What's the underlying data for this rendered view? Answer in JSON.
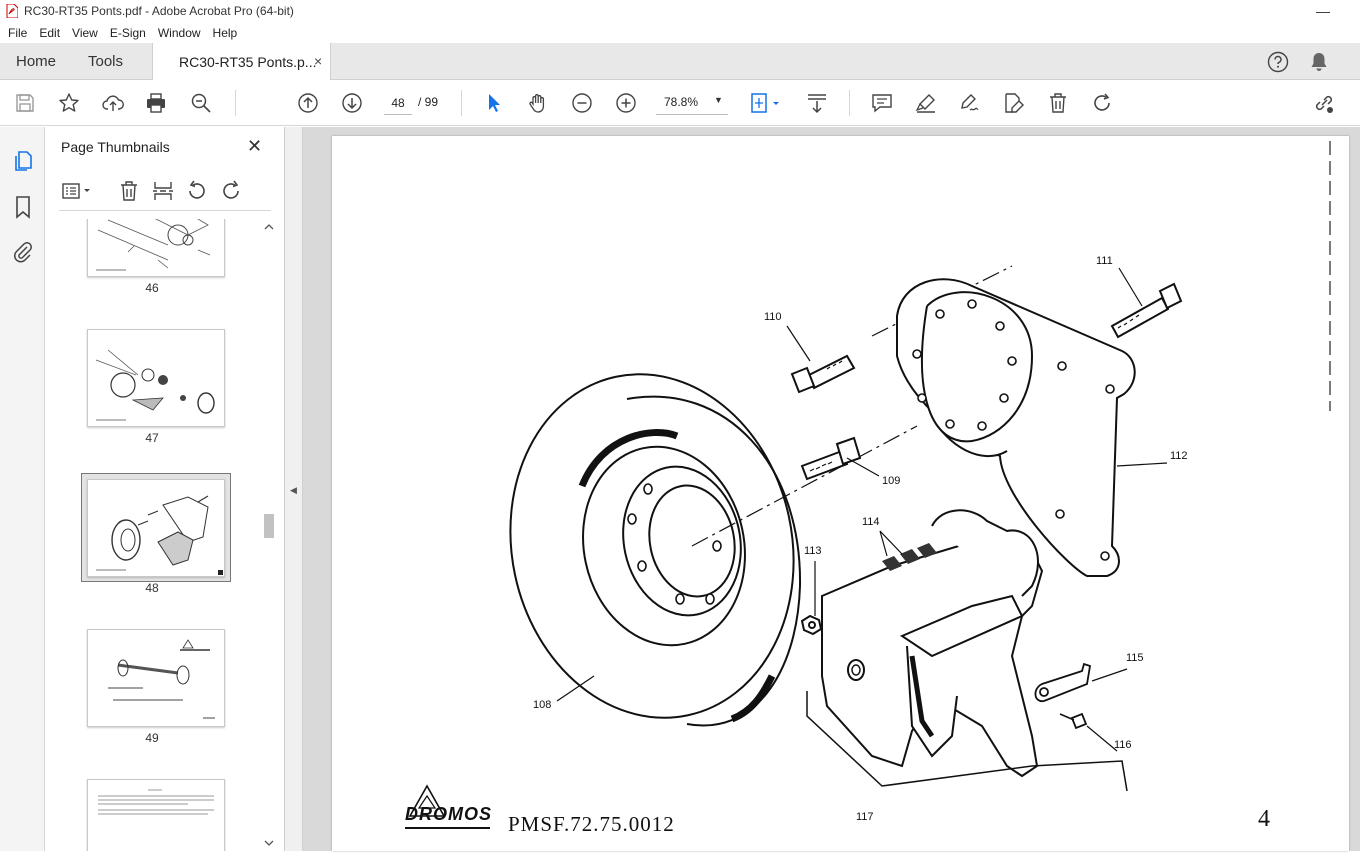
{
  "window": {
    "title": "RC30-RT35 Ponts.pdf - Adobe Acrobat Pro (64-bit)",
    "min_glyph": "—"
  },
  "menu": [
    "File",
    "Edit",
    "View",
    "E-Sign",
    "Window",
    "Help"
  ],
  "tabs": {
    "home": "Home",
    "tools": "Tools",
    "document": "RC30-RT35 Ponts.p...",
    "close": "×"
  },
  "toolbar": {
    "current_page": "48",
    "total_pages": "/ 99",
    "zoom": "78.8%"
  },
  "panel": {
    "title": "Page Thumbnails",
    "close": "✕",
    "thumbnails": [
      {
        "page": "46"
      },
      {
        "page": "47"
      },
      {
        "page": "48",
        "selected": true
      },
      {
        "page": "49"
      },
      {
        "page": ""
      }
    ]
  },
  "document_page": {
    "reference": "PMSF.72.75.0012",
    "page_number": "4",
    "logo_text": "DROMOS",
    "callouts": [
      "108",
      "109",
      "110",
      "111",
      "112",
      "113",
      "114",
      "115",
      "116",
      "117"
    ]
  },
  "colors": {
    "accent_blue": "#1473e6",
    "tabbar": "#e8e8e8",
    "viewer_bg": "#d9d9d9"
  }
}
